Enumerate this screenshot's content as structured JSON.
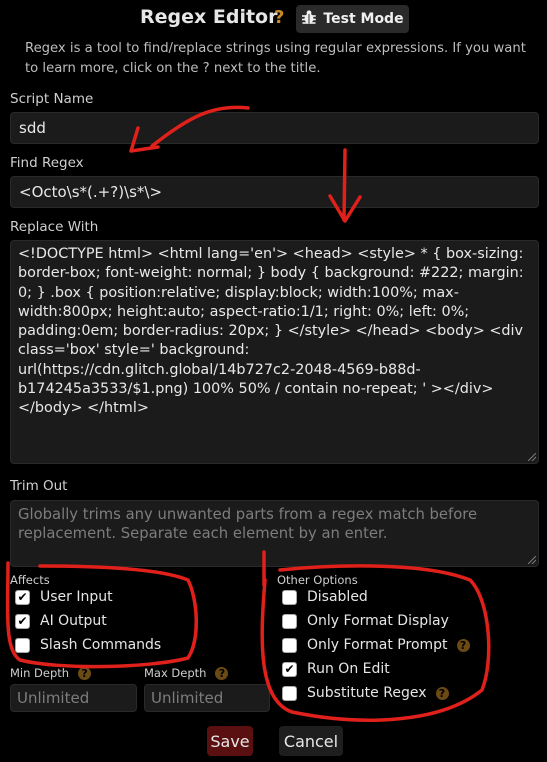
{
  "header": {
    "title": "Regex Editor",
    "help": "?",
    "test_mode_label": "Test Mode",
    "description": "Regex is a tool to find/replace strings using regular expressions. If you want to learn more, click on the ? next to the title."
  },
  "fields": {
    "script_name_label": "Script Name",
    "script_name_value": "sdd",
    "find_regex_label": "Find Regex",
    "find_regex_value": "<Octo\\s*(.+?)\\s*\\>",
    "replace_with_label": "Replace With",
    "replace_with_value": "<!DOCTYPE html> <html lang='en'> <head> <style> * { box-sizing: border-box; font-weight: normal; } body { background: #222; margin: 0; } .box { position:relative; display:block; width:100%; max-width:800px; height:auto; aspect-ratio:1/1; right: 0%; left: 0%; padding:0em; border-radius: 20px; } </style> </head> <body> <div class='box' style=' background: url(https://cdn.glitch.global/14b727c2-2048-4569-b88d-b174245a3533/$1.png) 100% 50% / contain no-repeat; ' ></div> </body> </html>",
    "trim_out_label": "Trim Out",
    "trim_out_placeholder": "Globally trims any unwanted parts from a regex match before replacement. Separate each element by an enter."
  },
  "affects": {
    "label": "Affects",
    "items": [
      {
        "label": "User Input",
        "checked": true
      },
      {
        "label": "AI Output",
        "checked": true
      },
      {
        "label": "Slash Commands",
        "checked": false
      }
    ]
  },
  "other_options": {
    "label": "Other Options",
    "items": [
      {
        "label": "Disabled",
        "checked": false,
        "help": false
      },
      {
        "label": "Only Format Display",
        "checked": false,
        "help": false
      },
      {
        "label": "Only Format Prompt",
        "checked": false,
        "help": true
      },
      {
        "label": "Run On Edit",
        "checked": true,
        "help": false
      },
      {
        "label": "Substitute Regex",
        "checked": false,
        "help": true
      }
    ]
  },
  "depth": {
    "min_label": "Min Depth",
    "max_label": "Max Depth",
    "min_placeholder": "Unlimited",
    "max_placeholder": "Unlimited",
    "help": "?"
  },
  "buttons": {
    "save": "Save",
    "cancel": "Cancel"
  },
  "colors": {
    "background": "#000000",
    "field_bg": "#1b1b1b",
    "help_accent": "#c8882a",
    "save_bg": "#5a1010",
    "annotation_red": "#e0201a"
  }
}
